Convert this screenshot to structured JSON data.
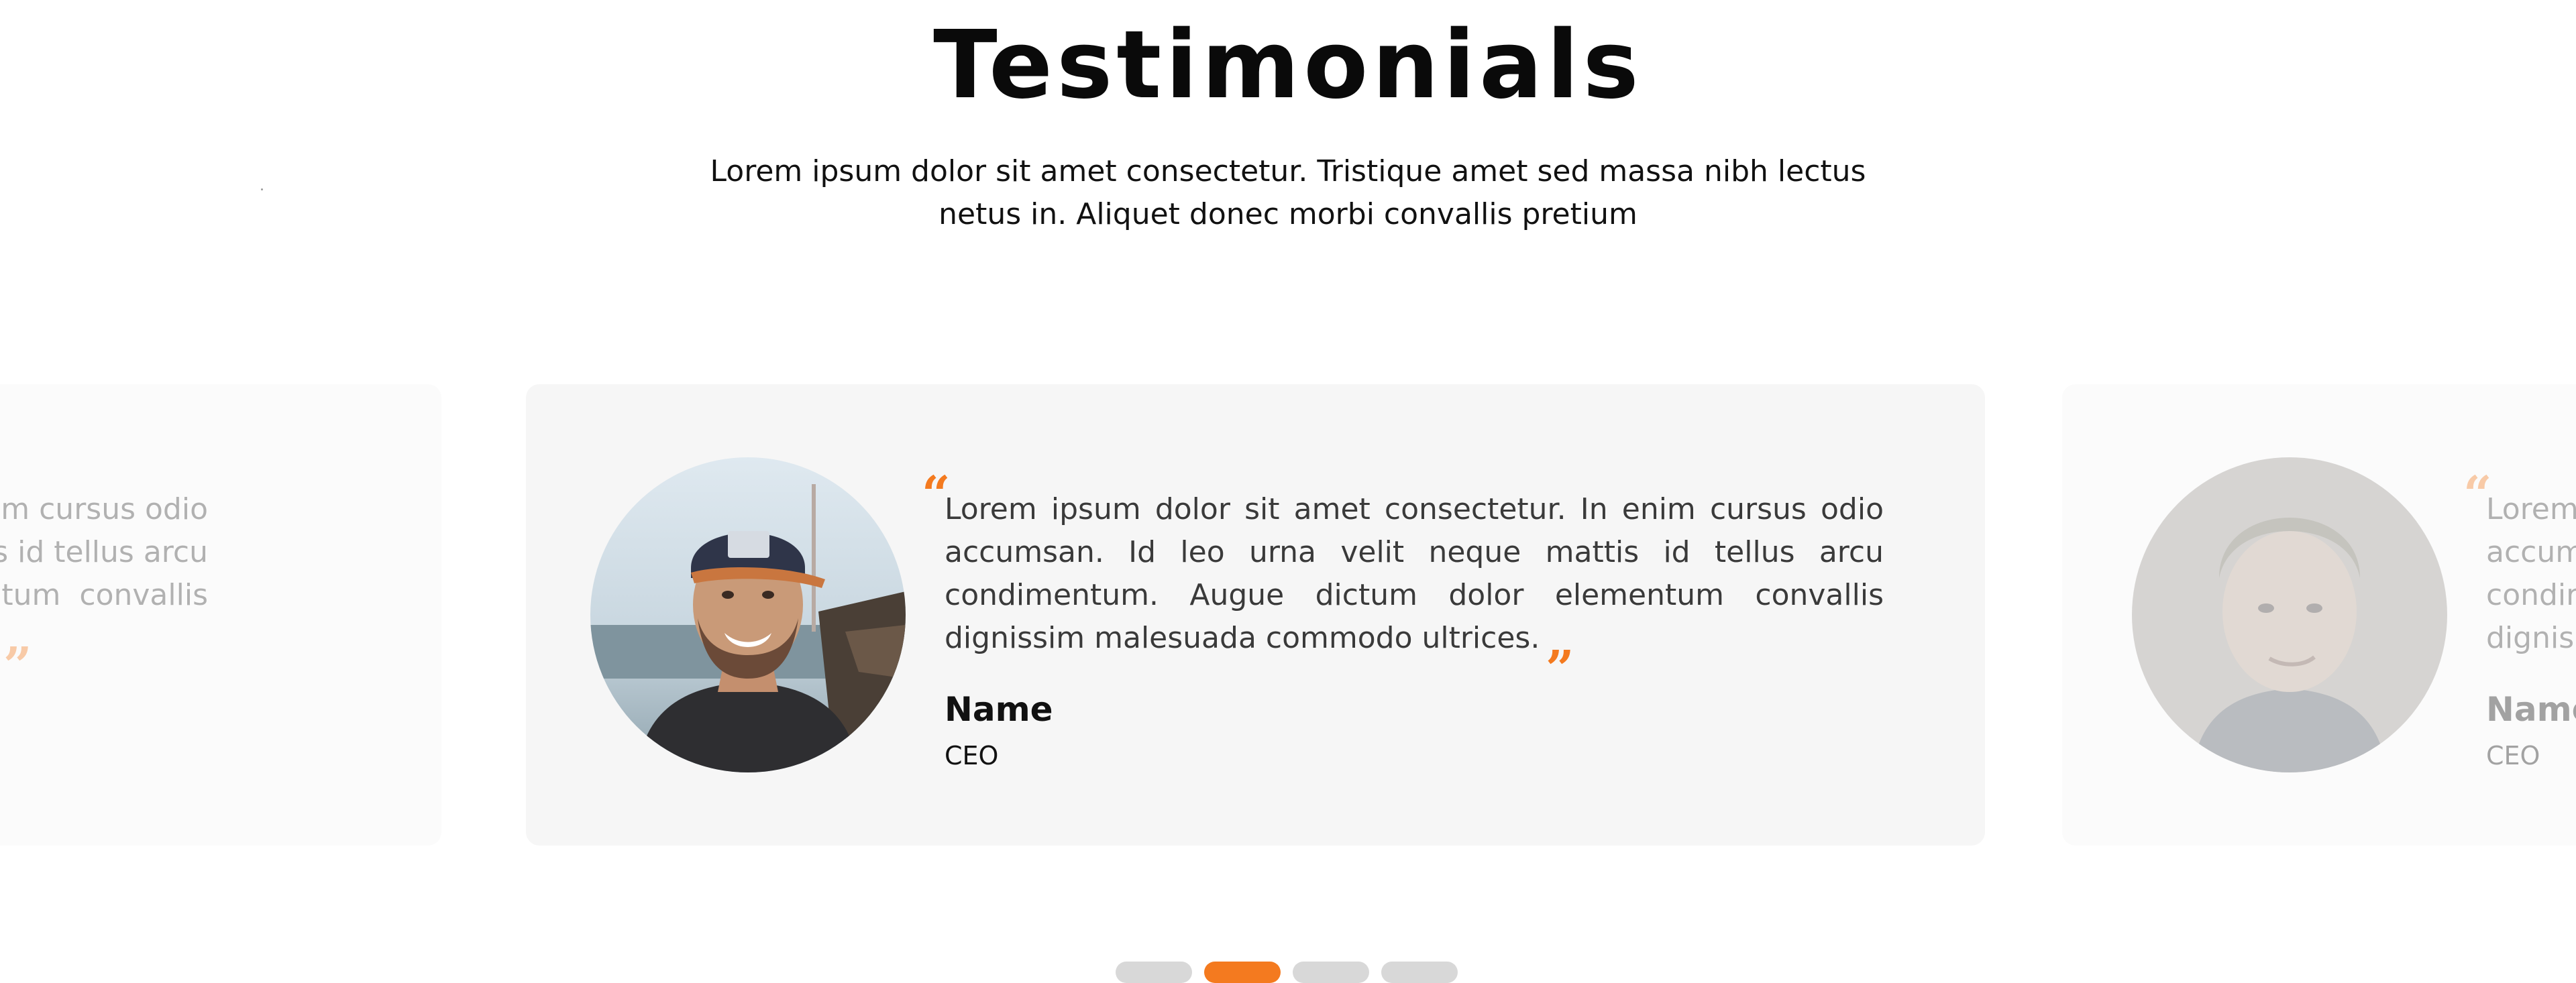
{
  "section": {
    "title": "Testimonials",
    "subtitle_line1": "Lorem ipsum dolor sit amet consectetur. Tristique amet sed massa nibh lectus",
    "subtitle_line2": "netus in. Aliquet donec morbi convallis pretium"
  },
  "colors": {
    "accent": "#f47a1f",
    "card_background": "#f6f6f6",
    "pager_inactive": "#d8d8d8"
  },
  "testimonials": [
    {
      "text": "Lorem ipsum dolor sit amet consectetur. In enim cursus odio accumsan. Id leo urna velit neque mattis id tellus arcu condimentum. Augue dictum dolor elementum convallis dignissim malesuada commodo ultrices.",
      "visible_text": "ur. In enim cursus odio mattis id tellus arcu elementum convallis",
      "state": "previous"
    },
    {
      "text": "Lorem ipsum dolor sit amet consectetur. In enim cursus odio accumsan. Id leo urna velit neque mattis id tellus arcu condimentum. Augue dictum dolor elementum convallis dignissim malesuada commodo ultrices.",
      "name": "Name",
      "role": "CEO",
      "state": "active"
    },
    {
      "text": "Lorem accum condir dignis",
      "name": "Name",
      "role": "CEO",
      "state": "next"
    }
  ],
  "quote_open": "“",
  "quote_close": "”",
  "pager": {
    "count": 4,
    "active_index": 1
  }
}
